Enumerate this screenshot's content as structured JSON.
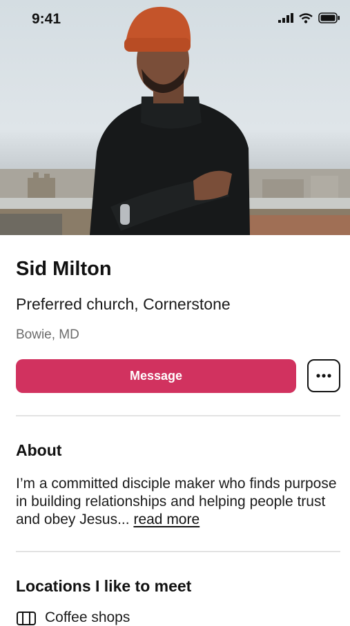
{
  "status_bar": {
    "time": "9:41"
  },
  "hero": {
    "photo": "portrait-photo"
  },
  "profile": {
    "name": "Sid Milton",
    "church": "Preferred church, Cornerstone",
    "location": "Bowie, MD"
  },
  "actions": {
    "message_label": "Message",
    "more_icon": "ellipsis-icon"
  },
  "about": {
    "heading": "About",
    "body": "I’m a committed disciple maker who finds purpose in building relationships and helping people trust and obey Jesus...",
    "read_more_label": "read more"
  },
  "locations": {
    "heading": "Locations I like to meet",
    "items": [
      {
        "icon": "coffee-shop-icon",
        "label": "Coffee shops"
      }
    ]
  },
  "colors": {
    "accent": "#d1325f",
    "text": "#111111",
    "muted": "#6b6b6b",
    "divider": "#e2e2e2"
  }
}
